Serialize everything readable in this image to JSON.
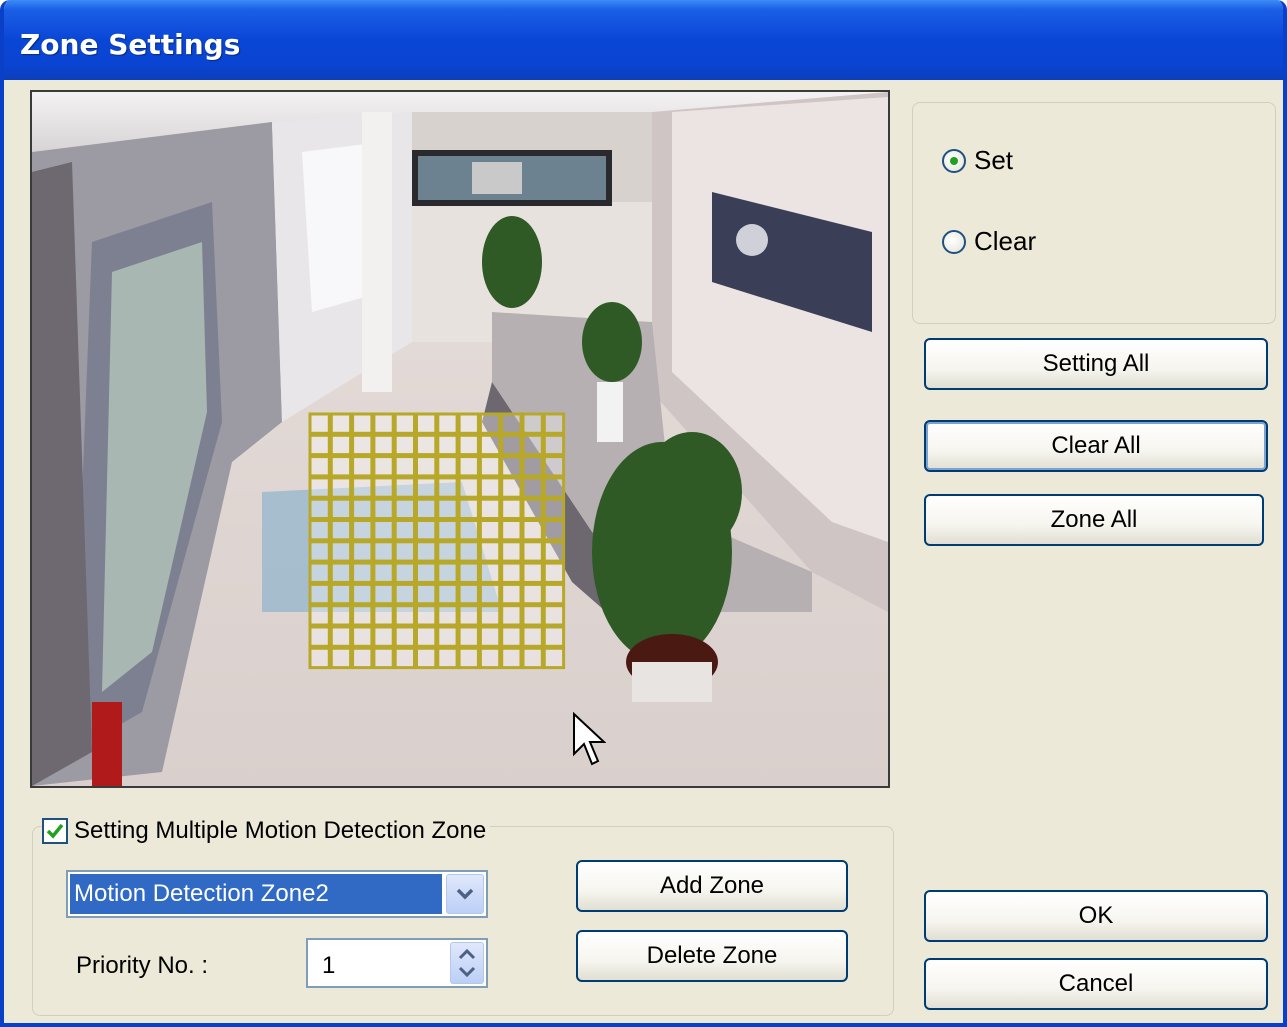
{
  "window": {
    "title": "Zone Settings"
  },
  "mode": {
    "options": [
      {
        "label": "Set",
        "checked": true
      },
      {
        "label": "Clear",
        "checked": false
      }
    ]
  },
  "buttons": {
    "setting_all": "Setting All",
    "clear_all": "Clear All",
    "zone_all": "Zone All",
    "add_zone": "Add Zone",
    "delete_zone": "Delete Zone",
    "ok": "OK",
    "cancel": "Cancel"
  },
  "multi_zone": {
    "checkbox_label": "Setting Multiple Motion Detection Zone",
    "checked": true,
    "selected_zone": "Motion Detection Zone2",
    "priority_label": "Priority No. :",
    "priority_value": "1"
  },
  "motion_grid": {
    "columns": 12,
    "rows": 12,
    "color": "#b8a82a"
  },
  "icons": {
    "title": "none",
    "dropdown": "chevron-down-icon",
    "spinner": "up-down-arrows-icon",
    "checkbox": "checkmark-icon",
    "cursor": "mouse-pointer-icon"
  }
}
